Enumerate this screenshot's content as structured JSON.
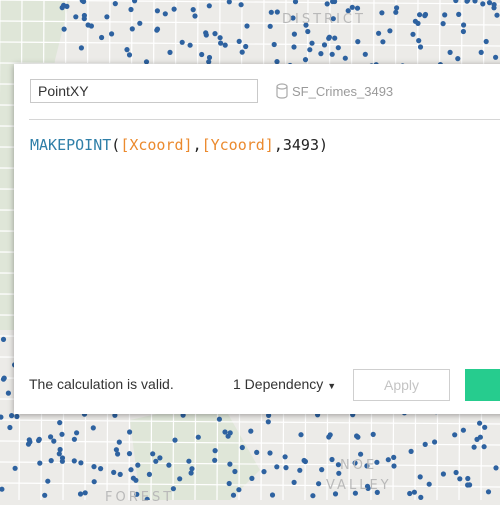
{
  "map": {
    "labels": [
      "DISTRICT",
      "NOE",
      "VALLEY",
      "FOREST"
    ],
    "dot_color": "#2e62a0"
  },
  "dialog": {
    "name_value": "PointXY",
    "datasource_icon": "database-icon",
    "datasource": "SF_Crimes_3493",
    "formula": {
      "function": "MAKEPOINT",
      "open": "(",
      "field1": "[Xcoord]",
      "sep1": ",",
      "field2": "[Ycoord]",
      "sep2": ",",
      "arg3": "3493",
      "close": ")"
    },
    "status": "The calculation is valid.",
    "dependency_label": "1 Dependency",
    "dependency_icon": "caret-down-icon",
    "apply_label": "Apply",
    "ok_color": "#26cc8e"
  }
}
